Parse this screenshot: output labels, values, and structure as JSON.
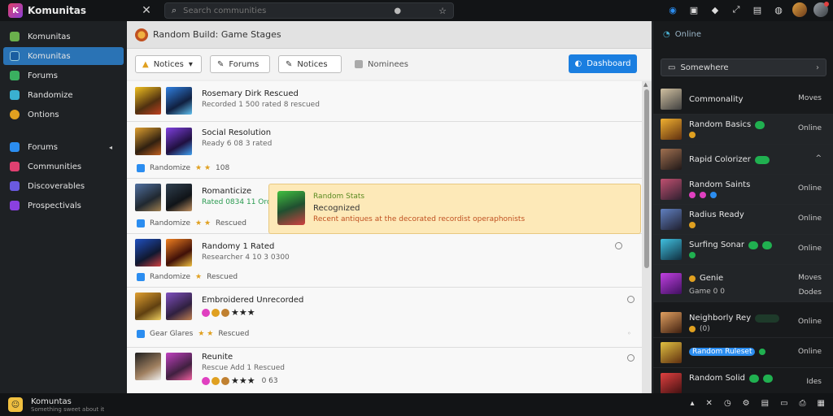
{
  "app": {
    "title": "Komunitas",
    "logo_glyph": "K",
    "close_glyph": "✕"
  },
  "search": {
    "placeholder": "Search communities"
  },
  "top_icons": [
    "refresh-icon",
    "bookmark-icon",
    "tag-icon",
    "expand-icon",
    "document-icon",
    "globe-icon"
  ],
  "sidebar": {
    "items": [
      {
        "label": "Komunitas",
        "color": "#6ab04c",
        "active": false
      },
      {
        "label": "Komunitas",
        "color": "#2b8df0",
        "active": true
      },
      {
        "label": "Forums",
        "color": "#3ab060",
        "active": false
      },
      {
        "label": "Randomize",
        "color": "#3ab0d0",
        "active": false
      },
      {
        "label": "Ontions",
        "color": "#e0a020",
        "active": false
      }
    ],
    "group": [
      {
        "label": "Forums",
        "color": "#2b8df0",
        "caret": "◂"
      },
      {
        "label": "Communities",
        "color": "#e04070"
      },
      {
        "label": "Discoverables",
        "color": "#6a5ae0"
      },
      {
        "label": "Prospectivals",
        "color": "#8a40e0"
      }
    ]
  },
  "main": {
    "header": "Random Build: Game Stages",
    "toolbar": {
      "b1": "Notices",
      "b2": "Forums",
      "b3": "Notices",
      "label": "Nominees",
      "primary": "Dashboard"
    },
    "rows": [
      {
        "title": "Rosemary Dirk Rescued",
        "sub": "Recorded 1 500 rated 8 rescued",
        "meta": ""
      },
      {
        "title": "Social Resolution",
        "sub": "Ready 6 08 3 rated",
        "meta": "Randomize",
        "meta_count": "108"
      },
      {
        "title": "Romanticize",
        "sub": "Rated 0834 11 Orchestrated",
        "meta": "Randomize",
        "meta_count": "Rescued"
      },
      {
        "title": "Randomy 1 Rated",
        "sub": "Researcher 4 10 3 0300",
        "meta": "Randomize",
        "meta_count": "Rescued"
      },
      {
        "title": "Embroidered Unrecorded",
        "sub": "",
        "meta": "Gear Glares",
        "meta_count": "Rescued"
      },
      {
        "title": "Reunite",
        "sub": "Rescue Add 1 Rescued",
        "meta": "",
        "meta_count": "0 63"
      }
    ],
    "tooltip": {
      "line1": "Random Stats",
      "line2": "Recognized",
      "line3": "Recent antiques at the decorated recordist operaphonists"
    }
  },
  "right": {
    "header": "Online",
    "search": "Somewhere",
    "people": [
      {
        "name": "Commonality",
        "status": "Moves"
      },
      {
        "name": "Random Basics",
        "status": "Online"
      },
      {
        "name": "Rapid Colorizer",
        "status": "^"
      },
      {
        "name": "Random Saints",
        "status": "Online"
      },
      {
        "name": "Radius Ready",
        "status": "Online"
      },
      {
        "name": "Surfing Sonar",
        "status": "Online"
      },
      {
        "name": "Genie",
        "sub": "Game 0 0",
        "status": "Moves",
        "status2": "Dodes"
      },
      {
        "name": "Neighborly Rey",
        "sub": "(0)",
        "status": "Online"
      },
      {
        "name": "Random Ruleset",
        "status": "Online"
      },
      {
        "name": "Random Solid",
        "status": "Ides"
      }
    ]
  },
  "bottombar": {
    "logo_glyph": "☺",
    "title": "Komuntas",
    "sub": "Something sweet about it"
  }
}
